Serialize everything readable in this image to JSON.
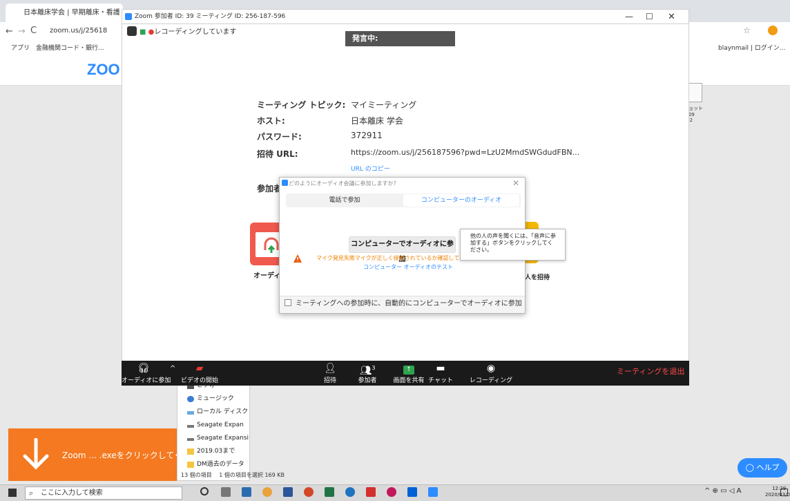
{
  "chrome": {
    "tab_title": "日本離床学会 | 早期離床・看護",
    "address": "zoom.us/j/25618",
    "bookmarks": [
      "アプリ",
      "金融機関コード・銀行..."
    ],
    "right_bookmark": "blaynmail | ログイン..."
  },
  "site": {
    "logo_text": "ZOO"
  },
  "zoom_window": {
    "title": "Zoom 参加者 ID: 39 ミーティング ID: 256-187-596",
    "recording_label": "レコーディングしています",
    "talking_label": "発言中:",
    "info": [
      {
        "label": "ミーティング トピック:",
        "value": "マイミーティング"
      },
      {
        "label": "ホスト:",
        "value": "日本離床 学会"
      },
      {
        "label": "パスワード:",
        "value": "372911"
      },
      {
        "label": "招待 URL:",
        "value": "https://zoom.us/j/256187596?pwd=LzU2MmdSWGdudFBN..."
      }
    ],
    "copy_url": "URL のコピー",
    "participants_label": "参加者 I",
    "tile_audio_label": "オーディオに",
    "tile_invite_label": "人を招待"
  },
  "audio_dialog": {
    "title": "どのようにオーディオ会議に参加しますか?",
    "tab_phone": "電話で参加",
    "tab_computer": "コンピューターのオーディオ",
    "join_button": "コンピューターでオーディオに参加",
    "warning_text": "マイク発見失敗マイクが正しく接続されているか確認してください",
    "test_link": "コンピューター オーディオのテスト",
    "auto_join": "ミーティングへの参加時に、自動的にコンピューターでオーディオに参加",
    "tooltip": "他の人の声を聞くには、「音声に参加する」ボタンをクリックしてください。"
  },
  "zoom_toolbar": {
    "join_audio": "オーディオに参加",
    "start_video": "ビデオの開始",
    "invite": "招待",
    "participants": "参加者",
    "participants_count": "3",
    "share_screen": "画面を共有",
    "chat": "チャット",
    "record": "レコーディング",
    "leave": "ミーティングを退出"
  },
  "explorer": {
    "items": [
      "ビデオ",
      "ミュージック",
      "ローカル ディスク",
      "Seagate Expan",
      "Seagate Expansi",
      "2019.03まで",
      "DM過去のデータ"
    ],
    "status": "13 個の項目　 1 個の項目を選択 169 KB"
  },
  "download": {
    "text": "Zoom ... .exeをクリックしてくだ"
  },
  "right_panel": {
    "file_label": "ンショット\n-03-09\n25.02"
  },
  "help_button": "ヘルプ",
  "taskbar": {
    "search_placeholder": "ここに入力して検索",
    "time": "12:29",
    "date": "2020/03/09",
    "ime": "A"
  },
  "colors": {
    "zoom_blue": "#2d8cff",
    "leave_red": "#ff4a4a",
    "warning_orange": "#f08000",
    "download_orange": "#f47920"
  }
}
